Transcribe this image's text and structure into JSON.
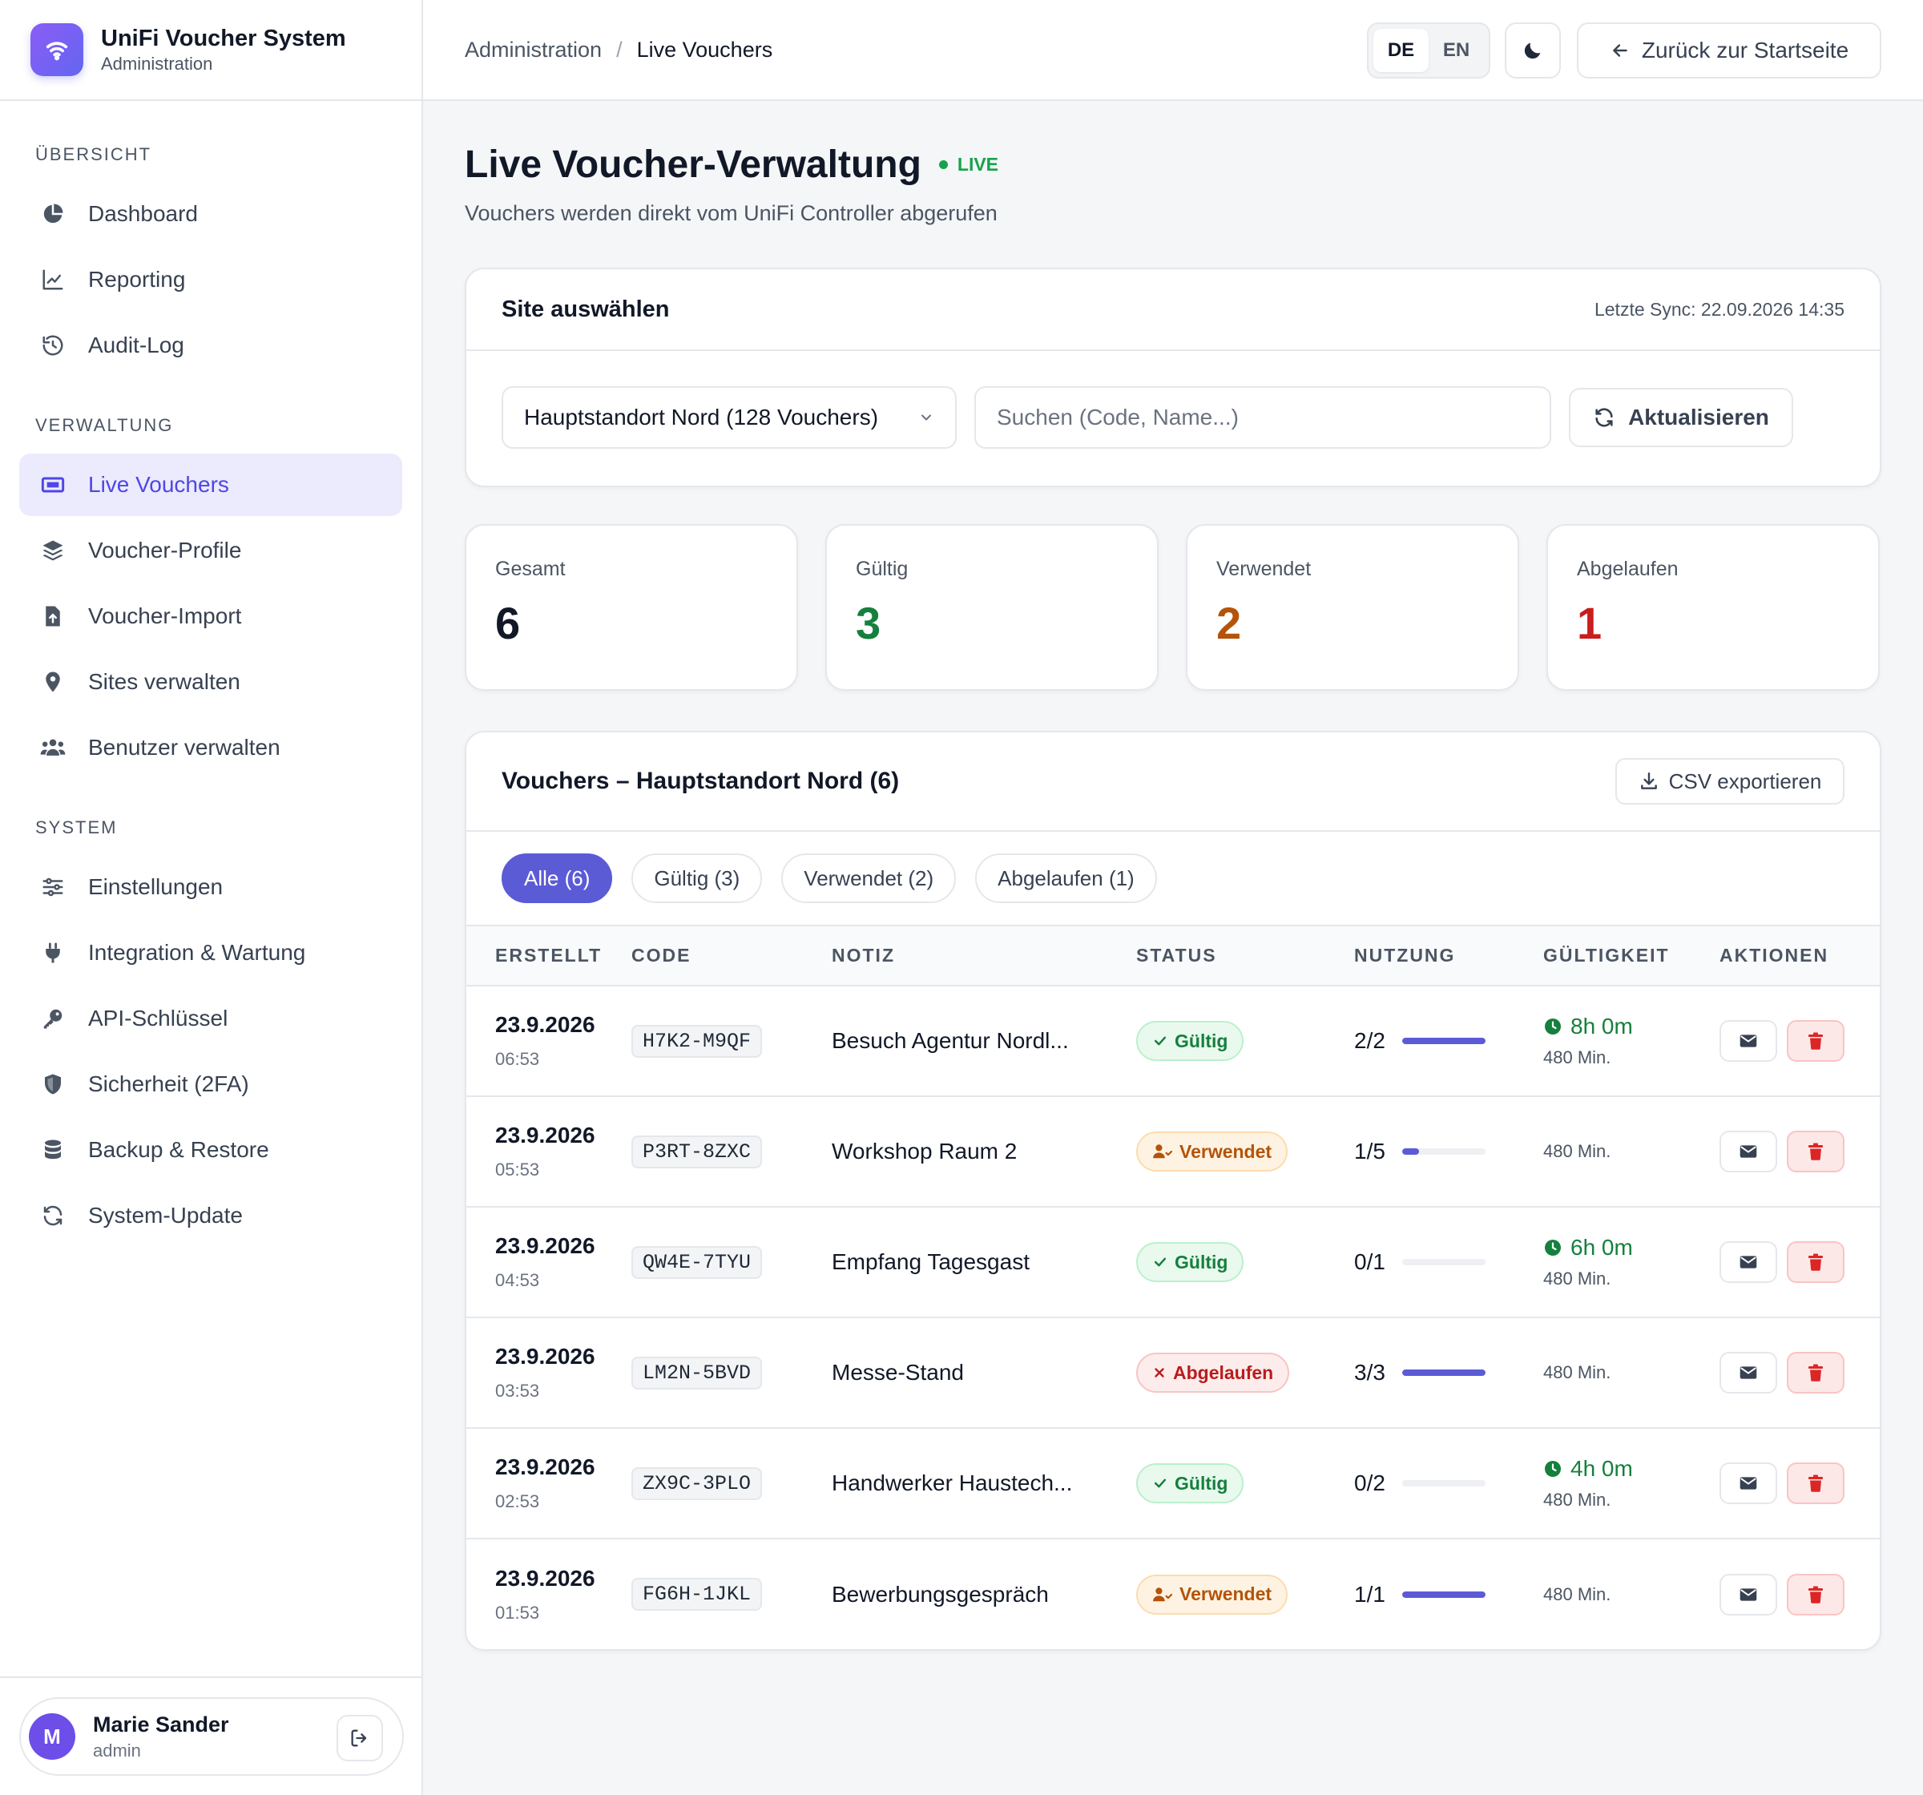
{
  "brand": {
    "title": "UniFi Voucher System",
    "subtitle": "Administration"
  },
  "sidebar": {
    "sections": [
      {
        "title": "ÜBERSICHT",
        "items": [
          {
            "label": "Dashboard",
            "icon": "pie-chart-icon"
          },
          {
            "label": "Reporting",
            "icon": "line-chart-icon"
          },
          {
            "label": "Audit-Log",
            "icon": "history-icon"
          }
        ]
      },
      {
        "title": "VERWALTUNG",
        "items": [
          {
            "label": "Live Vouchers",
            "icon": "ticket-icon",
            "active": true
          },
          {
            "label": "Voucher-Profile",
            "icon": "layers-icon"
          },
          {
            "label": "Voucher-Import",
            "icon": "file-upload-icon"
          },
          {
            "label": "Sites verwalten",
            "icon": "map-pin-icon"
          },
          {
            "label": "Benutzer verwalten",
            "icon": "users-icon"
          }
        ]
      },
      {
        "title": "SYSTEM",
        "items": [
          {
            "label": "Einstellungen",
            "icon": "sliders-icon"
          },
          {
            "label": "Integration & Wartung",
            "icon": "plug-icon"
          },
          {
            "label": "API-Schlüssel",
            "icon": "key-icon"
          },
          {
            "label": "Sicherheit (2FA)",
            "icon": "shield-icon"
          },
          {
            "label": "Backup & Restore",
            "icon": "database-icon"
          },
          {
            "label": "System-Update",
            "icon": "refresh-icon"
          }
        ]
      }
    ]
  },
  "user": {
    "initial": "M",
    "name": "Marie Sander",
    "role": "admin"
  },
  "topbar": {
    "breadcrumb_parent": "Administration",
    "breadcrumb_sep": "/",
    "breadcrumb_current": "Live Vouchers",
    "lang_de": "DE",
    "lang_en": "EN",
    "back_label": "Zurück zur Startseite"
  },
  "page": {
    "title": "Live Voucher-Verwaltung",
    "live_label": "LIVE",
    "subtitle": "Vouchers werden direkt vom UniFi Controller abgerufen"
  },
  "site_card": {
    "title": "Site auswählen",
    "last_sync": "Letzte Sync: 22.09.2026 14:35",
    "selected_site": "Hauptstandort Nord (128 Vouchers)",
    "search_placeholder": "Suchen (Code, Name...)",
    "search_value": "",
    "refresh_label": "Aktualisieren"
  },
  "stats": {
    "total": {
      "label": "Gesamt",
      "value": "6",
      "color": "#111827"
    },
    "valid": {
      "label": "Gültig",
      "value": "3",
      "color": "#15803d"
    },
    "used": {
      "label": "Verwendet",
      "value": "2",
      "color": "#b45309"
    },
    "expired": {
      "label": "Abgelaufen",
      "value": "1",
      "color": "#c81e1e"
    }
  },
  "list": {
    "title": "Vouchers – Hauptstandort Nord (6)",
    "csv_label": "CSV exportieren",
    "filters": [
      "Alle (6)",
      "Gültig (3)",
      "Verwendet (2)",
      "Abgelaufen (1)"
    ],
    "columns": [
      "ERSTELLT",
      "CODE",
      "NOTIZ",
      "STATUS",
      "NUTZUNG",
      "GÜLTIGKEIT",
      "AKTIONEN"
    ],
    "rows": [
      {
        "date": "23.9.2026",
        "time": "06:53",
        "code": "H7K2-M9QF",
        "note": "Besuch Agentur Nordl...",
        "status": "Gültig",
        "status_type": "valid",
        "usage": "2/2",
        "usage_ratio": 1.0,
        "remaining": "8h 0m",
        "minutes": "480 Min."
      },
      {
        "date": "23.9.2026",
        "time": "05:53",
        "code": "P3RT-8ZXC",
        "note": "Workshop Raum 2",
        "status": "Verwendet",
        "status_type": "used",
        "usage": "1/5",
        "usage_ratio": 0.2,
        "remaining": "",
        "minutes": "480 Min."
      },
      {
        "date": "23.9.2026",
        "time": "04:53",
        "code": "QW4E-7TYU",
        "note": "Empfang Tagesgast",
        "status": "Gültig",
        "status_type": "valid",
        "usage": "0/1",
        "usage_ratio": 0.0,
        "remaining": "6h 0m",
        "minutes": "480 Min."
      },
      {
        "date": "23.9.2026",
        "time": "03:53",
        "code": "LM2N-5BVD",
        "note": "Messe-Stand",
        "status": "Abgelaufen",
        "status_type": "expired",
        "usage": "3/3",
        "usage_ratio": 1.0,
        "remaining": "",
        "minutes": "480 Min."
      },
      {
        "date": "23.9.2026",
        "time": "02:53",
        "code": "ZX9C-3PLO",
        "note": "Handwerker Haustech...",
        "status": "Gültig",
        "status_type": "valid",
        "usage": "0/2",
        "usage_ratio": 0.0,
        "remaining": "4h 0m",
        "minutes": "480 Min."
      },
      {
        "date": "23.9.2026",
        "time": "01:53",
        "code": "FG6H-1JKL",
        "note": "Bewerbungsgespräch",
        "status": "Verwendet",
        "status_type": "used",
        "usage": "1/1",
        "usage_ratio": 1.0,
        "remaining": "",
        "minutes": "480 Min."
      }
    ]
  },
  "colors": {
    "accent": "#5b5bd6",
    "valid": "#15803d",
    "used": "#b45309",
    "expired": "#c81e1e"
  }
}
